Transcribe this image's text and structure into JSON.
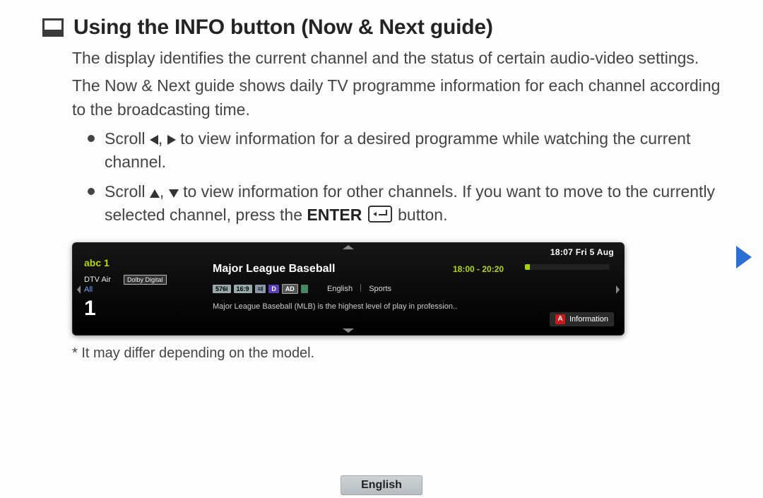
{
  "title": "Using the INFO button (Now & Next guide)",
  "intro1": "The display identifies the current channel and the status of certain audio-video settings.",
  "intro2": "The Now & Next guide shows daily TV programme information for each channel according to the broadcasting time.",
  "bullet1_a": "Scroll ",
  "bullet1_b": " to view information for a desired programme while watching the current channel.",
  "bullet2_a": "Scroll ",
  "bullet2_b": " to view information for other channels. If you want to move to the currently selected channel, press the ",
  "bullet2_enter": "ENTER",
  "bullet2_c": " button.",
  "banner": {
    "clock": "18:07 Fri 5 Aug",
    "channel_name": "abc 1",
    "signal": "DTV Air",
    "dolby": "Dolby Digital",
    "all": "All",
    "channel_number": "1",
    "program_title": "Major League Baseball",
    "program_time": "18:00 - 20:20",
    "badges": {
      "res": "576i",
      "aspect": "16:9",
      "teletext": "≡I",
      "d": "D",
      "ad": "AD"
    },
    "language": "English",
    "genre": "Sports",
    "description": "Major League Baseball (MLB) is the highest level of play in profession..",
    "info_button_letter": "A",
    "info_button_label": "Information"
  },
  "footnote": "* It may differ depending on the model.",
  "footer_language": "English"
}
